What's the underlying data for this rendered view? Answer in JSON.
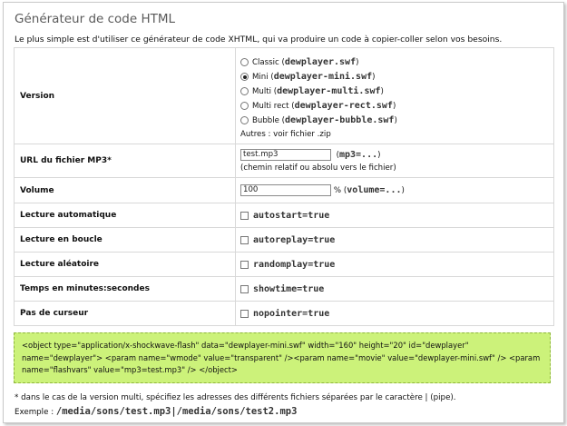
{
  "page": {
    "title": "Générateur de code HTML",
    "intro": "Le plus simple est d'utiliser ce générateur de code XHTML, qui va produire un code à copier-coller selon vos besoins."
  },
  "form": {
    "version": {
      "label": "Version",
      "options": [
        {
          "name": "Classic",
          "file": "dewplayer.swf",
          "selected": false
        },
        {
          "name": "Mini",
          "file": "dewplayer-mini.swf",
          "selected": true
        },
        {
          "name": "Multi",
          "file": "dewplayer-multi.swf",
          "selected": false
        },
        {
          "name": "Multi rect",
          "file": "dewplayer-rect.swf",
          "selected": false
        },
        {
          "name": "Bubble",
          "file": "dewplayer-bubble.swf",
          "selected": false
        }
      ],
      "others": "Autres : voir fichier .zip"
    },
    "url": {
      "label": "URL du fichier MP3*",
      "value": "test.mp3",
      "param": "mp3=...",
      "hint": "(chemin relatif ou absolu vers le fichier)"
    },
    "volume": {
      "label": "Volume",
      "value": "100",
      "unit": "%",
      "param": "volume=..."
    },
    "checks": [
      {
        "label": "Lecture automatique",
        "param": "autostart=true",
        "checked": false
      },
      {
        "label": "Lecture en boucle",
        "param": "autoreplay=true",
        "checked": false
      },
      {
        "label": "Lecture aléatoire",
        "param": "randomplay=true",
        "checked": false
      },
      {
        "label": "Temps en minutes:secondes",
        "param": "showtime=true",
        "checked": false
      },
      {
        "label": "Pas de curseur",
        "param": "nopointer=true",
        "checked": false
      }
    ]
  },
  "code": {
    "text": "<object type=\"application/x-shockwave-flash\" data=\"dewplayer-mini.swf\" width=\"160\" height=\"20\" id=\"dewplayer\" name=\"dewplayer\"> <param name=\"wmode\" value=\"transparent\" /><param name=\"movie\" value=\"dewplayer-mini.swf\" /> <param name=\"flashvars\" value=\"mp3=test.mp3\" /> </object>",
    "background": "#ccf27a"
  },
  "footer": {
    "note": "* dans le cas de la version multi, spécifiez les adresses des différents fichiers séparées par le caractère | (pipe).",
    "example_label": "Exemple :",
    "example_value": "/media/sons/test.mp3|/media/sons/test2.mp3"
  }
}
